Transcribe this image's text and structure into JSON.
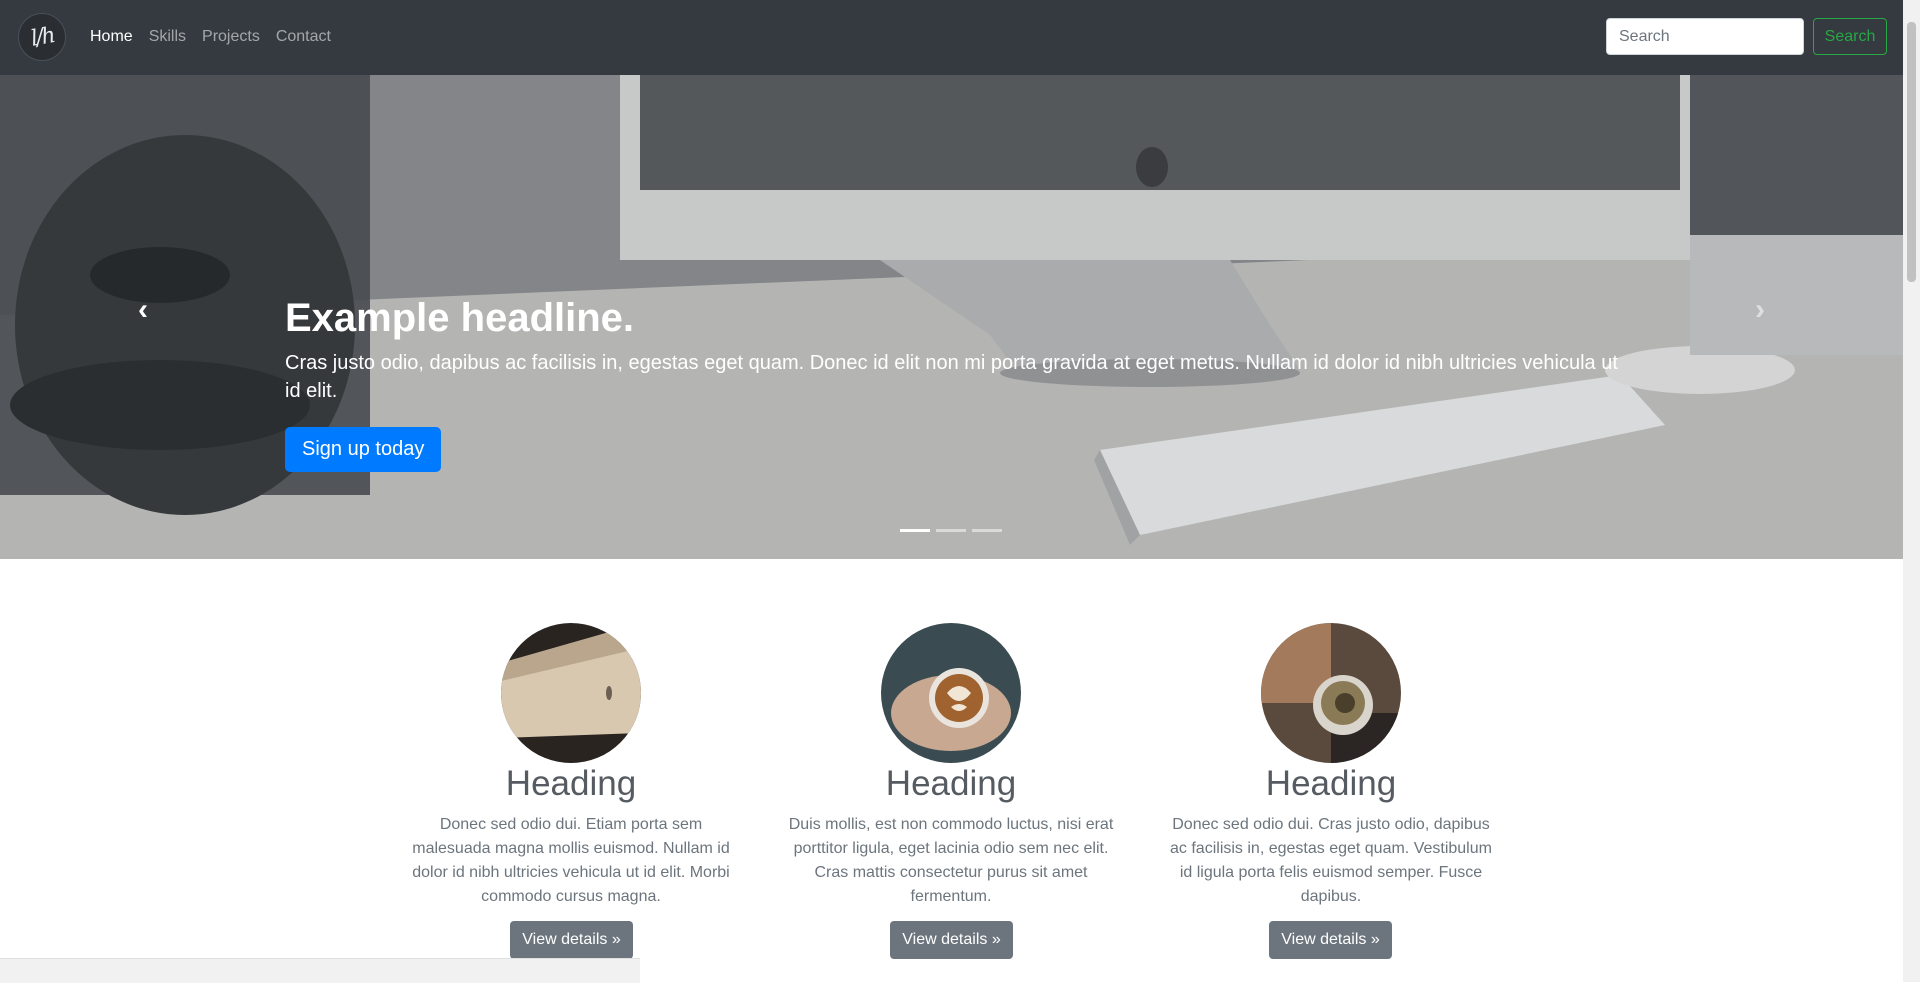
{
  "navbar": {
    "brand": "l/h",
    "links": [
      {
        "label": "Home",
        "active": true
      },
      {
        "label": "Skills",
        "active": false
      },
      {
        "label": "Projects",
        "active": false
      },
      {
        "label": "Contact",
        "active": false
      }
    ],
    "search_placeholder": "Search",
    "search_button": "Search"
  },
  "carousel": {
    "headline": "Example headline.",
    "text": "Cras justo odio, dapibus ac facilisis in, egestas eget quam. Donec id elit non mi porta gravida at eget metus. Nullam id dolor id nibh ultricies vehicula ut id elit.",
    "cta": "Sign up today",
    "prev_icon": "chevron-left-icon",
    "next_icon": "chevron-right-icon",
    "indicator_count": 3,
    "active_indicator": 0
  },
  "marketing": [
    {
      "heading": "Heading",
      "text": "Donec sed odio dui. Etiam porta sem malesuada magna mollis euismod. Nullam id dolor id nibh ultricies vehicula ut id elit. Morbi commodo cursus magna.",
      "button": "View details »"
    },
    {
      "heading": "Heading",
      "text": "Duis mollis, est non commodo luctus, nisi erat porttitor ligula, eget lacinia odio sem nec elit. Cras mattis consectetur purus sit amet fermentum.",
      "button": "View details »"
    },
    {
      "heading": "Heading",
      "text": "Donec sed odio dui. Cras justo odio, dapibus ac facilisis in, egestas eget quam. Vestibulum id ligula porta felis euismod semper. Fusce dapibus.",
      "button": "View details »"
    }
  ],
  "colors": {
    "navbar_bg": "#343a40",
    "primary": "#007bff",
    "success": "#28a745",
    "secondary": "#6c757d"
  }
}
